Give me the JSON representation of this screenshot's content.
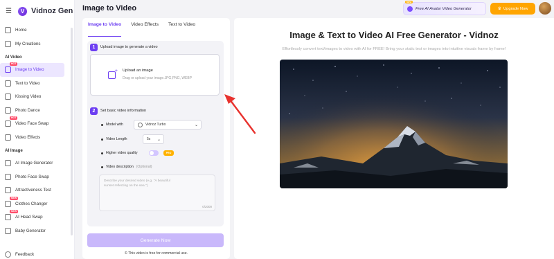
{
  "app": {
    "logo_text": "Vidnoz Gen"
  },
  "header": {
    "title": "Image to Video",
    "promo_label": "Free AI Avatar Video Generator",
    "promo_tag": "New",
    "upgrade_label": "Upgrade Now"
  },
  "sidebar": {
    "home": "Home",
    "creations": "My Creations",
    "section_video": "AI Video",
    "video_items": [
      {
        "label": "Image to Video",
        "tag": "HOT"
      },
      {
        "label": "Text to Video",
        "tag": ""
      },
      {
        "label": "Kissing Video",
        "tag": ""
      },
      {
        "label": "Photo Dance",
        "tag": ""
      },
      {
        "label": "Video Face Swap",
        "tag": "HOT"
      },
      {
        "label": "Video Effects",
        "tag": ""
      }
    ],
    "section_image": "AI Image",
    "image_items": [
      {
        "label": "AI Image Generator",
        "tag": ""
      },
      {
        "label": "Photo Face Swap",
        "tag": ""
      },
      {
        "label": "Attractiveness Test",
        "tag": ""
      },
      {
        "label": "Clothes Changer",
        "tag": "NEW"
      },
      {
        "label": "AI Head Swap",
        "tag": "NEW"
      },
      {
        "label": "Baby Generator",
        "tag": ""
      }
    ],
    "feedback": "Feedback"
  },
  "panel": {
    "tabs": [
      "Image to Video",
      "Video Effects",
      "Text to Video"
    ],
    "step1_num": "1",
    "step1_title": "Upload image to generate a video",
    "upload_title": "Upload an image",
    "upload_hint": "Drag or upload your image.JPG,PNG, WEBP",
    "step2_num": "2",
    "step2_title": "Set basic video information",
    "model_label": "Model with",
    "model_value": "Vidnoz Turbo",
    "length_label": "Video Length",
    "length_value": "5s",
    "quality_label": "Higher video quality",
    "quality_badge": "PRO",
    "desc_label": "Video description",
    "desc_optional": "(Optional)",
    "desc_placeholder": "Describe your desired video (e.g. \"A beautiful sunset reflecting on the sea.\")",
    "desc_counter": "0/2000",
    "generate_label": "Generate Now",
    "commercial_note": "This video is free for commercial use."
  },
  "hero": {
    "title": "Image & Text to Video AI Free Generator - Vidnoz",
    "subtitle": "Effortlessly convert text/images to video with AI for FREE! Bring your static text or images into intuitive visuals frame by frame!"
  },
  "colors": {
    "accent": "#6d3ff2",
    "upgrade": "#ffa500",
    "arrow": "#e8322e"
  }
}
